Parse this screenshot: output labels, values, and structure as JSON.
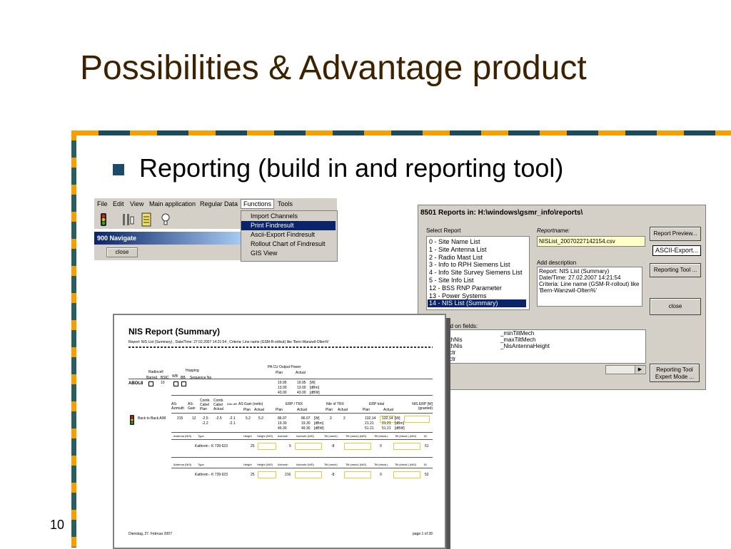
{
  "slide": {
    "title": "Possibilities & Advantage product",
    "bullet": "Reporting (build in and reporting tool)",
    "page_number": "10"
  },
  "app_menu": {
    "menu_items": [
      "File",
      "Edit",
      "View",
      "Main application",
      "Regular Data",
      "Functions",
      "Tools"
    ],
    "active_menu": "Functions",
    "dropdown_items": [
      "Import Channels",
      "Print Findresult",
      "Ascii-Export Findresult",
      "Rollout Chart of Findresult",
      "GIS View"
    ],
    "selected_dropdown": "Print Findresult",
    "nav_title": "900 Navigate",
    "close_label": "close",
    "toolbar_icons": [
      "traffic-light-icon",
      "antenna-icon",
      "list-icon",
      "lightbulb-icon"
    ]
  },
  "reports_window": {
    "title": "8501 Reports in: H:\\windows\\gsmr_info\\reports\\",
    "select_report_label": "Select Report",
    "reports": [
      "0 - Site Name List",
      "1 - Site Antenna List",
      "2 - Radio Mast List",
      "3 - Info to RPH Siemens List",
      "4 - Info Site Survey Siemens List",
      "5 - Site Info List",
      "12 - BSS RNP Parameter",
      "13 - Power Systems",
      "14 - NIS List (Summary)"
    ],
    "selected_report": "14 - NIS List (Summary)",
    "reportname_label": "Reportname:",
    "reportname_value": "NISList_20070227142154.csv",
    "description_label": "Add description",
    "description_lines": [
      "Report: NIS List (Summary)",
      "Date/Time: 27.02.2007 14:21:54",
      "Criteria: Line name (GSM-R-rollout)  like",
      "'Bern-Wanzwil-Olten%'"
    ],
    "fields_label": "ced on fields:",
    "fields_col1": [
      "e",
      "uthNis",
      "uthNis",
      "ectr",
      "ectr"
    ],
    "fields_col2": [
      "_minTiltMech",
      "_maxTiltMech",
      "_NisAntennaHeight"
    ],
    "buttons": [
      "Report Preview...",
      "ASCII-Export...",
      "Reporting Tool ...",
      "close",
      "Reporting Tool Expert Mode ..."
    ]
  },
  "nis_report": {
    "title": "NIS Report (Summary)",
    "subtitle": "Report: NIS List (Summary) , Date/Time: 27.02.2007 14:21:54 , Criteria: Line name (GSM-R-rollout)  like  'Bern-Wanzwil-Olten%'",
    "site_name": "ABOL8",
    "header1": [
      "Radiocell",
      "Barred",
      "BSIC",
      "WB",
      "BB",
      "Hopping",
      "Sequence No",
      "PA CU Output Power",
      "Plan",
      "Actual"
    ],
    "bsic": "10",
    "power_values": [
      "19.95",
      "13.00",
      "43.00"
    ],
    "power_units": [
      "[W]",
      "[dBm]",
      "[dBW]"
    ],
    "header2": [
      "AS-Azimuth",
      "AS-Gain",
      "Comb. Cabel Plan",
      "Comb. Cabel Actual",
      "Attn-diff",
      "AS Gain (netto)",
      "Plan",
      "Actual",
      "ERP / TRX",
      "Plan",
      "Actual",
      "Nbr of TRX",
      "Plan",
      "Actual",
      "ERP total",
      "Plan",
      "Actual",
      "NIS ERP [W] (granted)"
    ],
    "row": {
      "label": "Back to Back A08",
      "azimuth": "215",
      "gain": "12",
      "comb_plan": "-2.5",
      "comb_plan2": "-2.2",
      "comb_act": "-2.5",
      "diff": "-2.1",
      "diff2": "-2.1",
      "gain_plan": "5.2",
      "gain_act": "5.2",
      "erp_plan": [
        "86.07",
        "19.30",
        "49.30"
      ],
      "erp_act": [
        "86.07",
        "19.30",
        "49.30"
      ],
      "trx_plan": "2",
      "trx_act": "2",
      "total_plan": [
        "132.14",
        "21.21",
        "51.21"
      ],
      "total_act": [
        "132.14",
        "21.21",
        "51.21"
      ]
    },
    "antenna_header": [
      "Antenna (NIS)",
      "Type",
      "Height",
      "Height (NIS)",
      "Azimuth",
      "Azimuth (NIS)",
      "Tilt (mech)",
      "Tilt (mech) (NIS)",
      "Tilt (electr.)",
      "Tilt (electr.) (NIS)",
      "ID"
    ],
    "antenna_rows": [
      {
        "type": "Kathrein - K 739 623",
        "height": "25",
        "azimuth": "5",
        "tilt": "-8",
        "tilt_el": "0",
        "id": "51"
      },
      {
        "type": "Kathrein - K 739 623",
        "height": "25",
        "azimuth": "216",
        "tilt": "-8",
        "tilt_el": "0",
        "id": "52"
      }
    ],
    "footer_left": "Dienstag, 27. Februar 2007",
    "footer_right": "page 1 of 39"
  }
}
